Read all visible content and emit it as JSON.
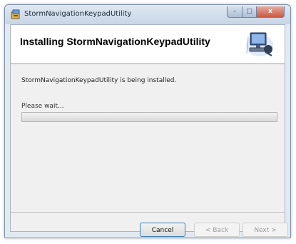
{
  "window": {
    "title": "StormNavigationKeypadUtility",
    "controls": {
      "minimize": "–",
      "maximize": "□",
      "close": "x"
    }
  },
  "header": {
    "title": "Installing StormNavigationKeypadUtility",
    "image_icon": "computer-installer-icon"
  },
  "body": {
    "status_text": "StormNavigationKeypadUtility is being installed.",
    "wait_label": "Please wait...",
    "progress_fraction": 0
  },
  "buttons": {
    "cancel": "Cancel",
    "back": "< Back",
    "next": "Next >"
  },
  "colors": {
    "accent": "#3c7fb1",
    "window_frame": "#e3e9f1",
    "close_button": "#c65a44"
  }
}
